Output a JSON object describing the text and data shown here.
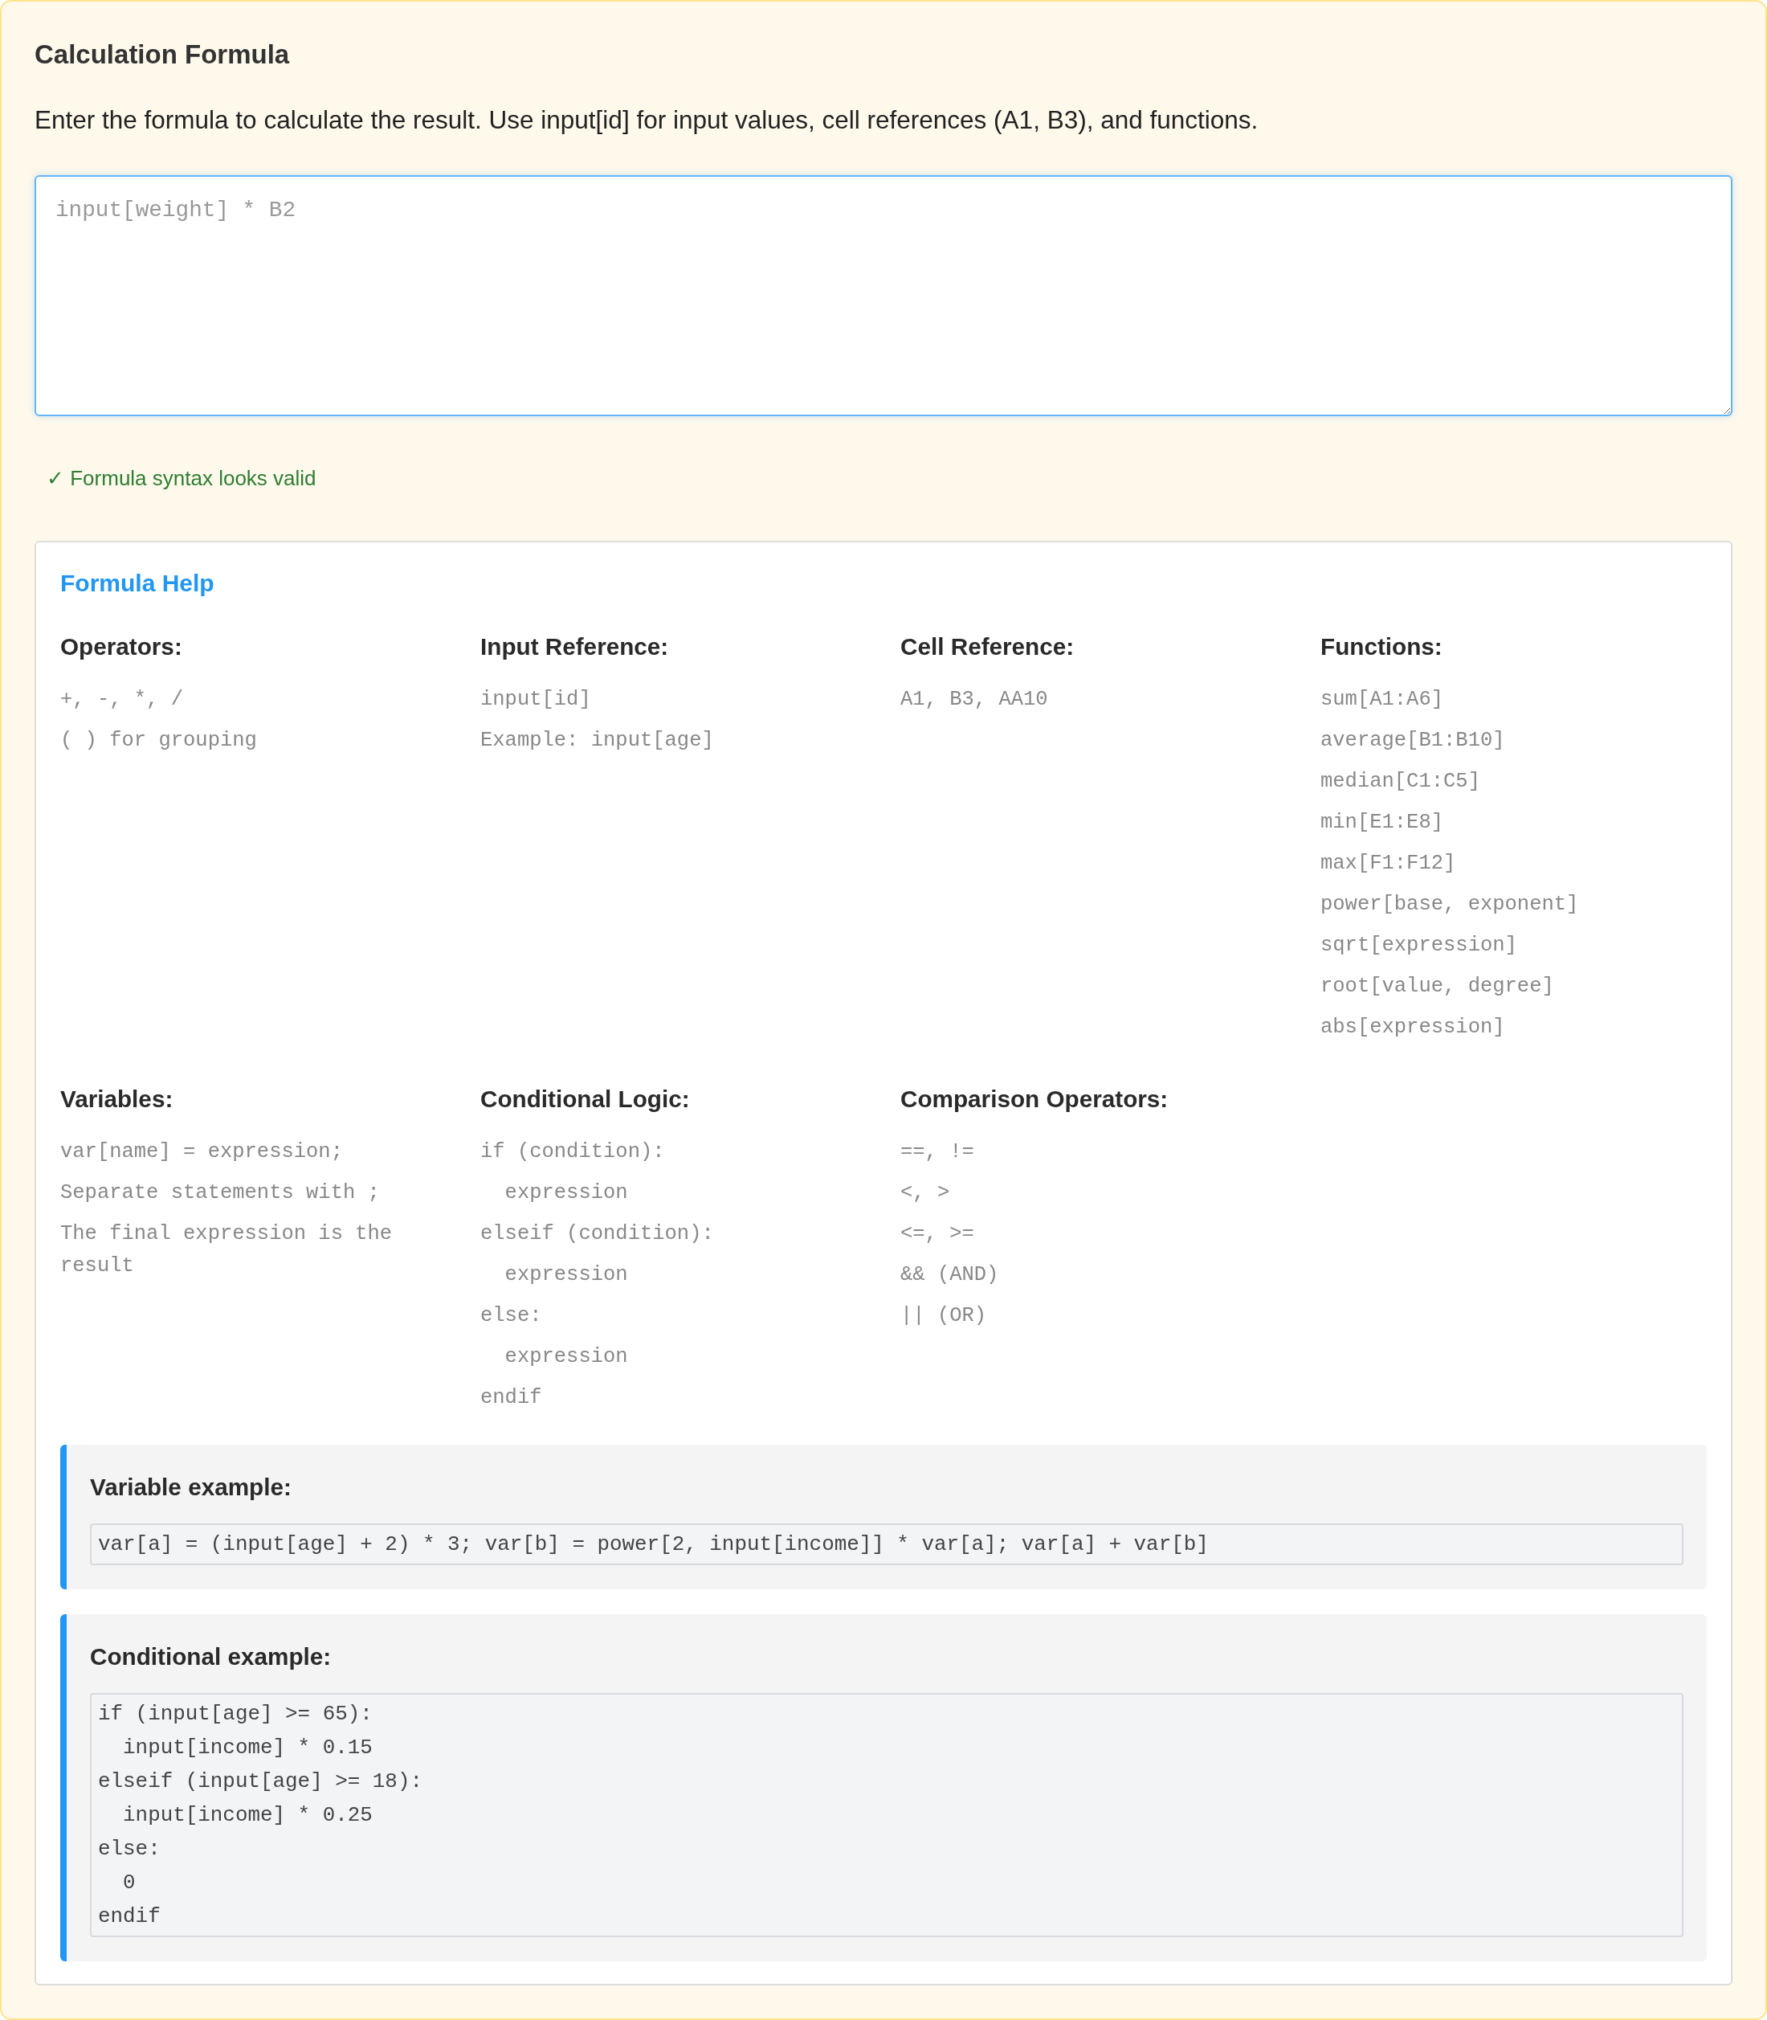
{
  "panel": {
    "title": "Calculation Formula",
    "description": "Enter the formula to calculate the result. Use input[id] for input values, cell references (A1, B3), and functions."
  },
  "formula_field": {
    "placeholder": "input[weight] * B2"
  },
  "validation": {
    "valid": true,
    "text": "✓ Formula syntax looks valid"
  },
  "help": {
    "title": "Formula Help",
    "sections": [
      {
        "heading": "Operators:",
        "items": [
          {
            "text": "+, -, *, /"
          },
          {
            "text": "( ) for grouping"
          }
        ]
      },
      {
        "heading": "Input Reference:",
        "items": [
          {
            "text": "input[id]"
          },
          {
            "text": "Example: input[age]"
          }
        ]
      },
      {
        "heading": "Cell Reference:",
        "items": [
          {
            "text": "A1, B3, AA10"
          }
        ]
      },
      {
        "heading": "Functions:",
        "items": [
          {
            "text": "sum[A1:A6]"
          },
          {
            "text": "average[B1:B10]"
          },
          {
            "text": "median[C1:C5]"
          },
          {
            "text": "min[E1:E8]"
          },
          {
            "text": "max[F1:F12]"
          },
          {
            "text": "power[base, exponent]"
          },
          {
            "text": "sqrt[expression]"
          },
          {
            "text": "root[value, degree]"
          },
          {
            "text": "abs[expression]"
          }
        ]
      },
      {
        "heading": "Variables:",
        "items": [
          {
            "text": "var[name] = expression;"
          },
          {
            "text": "Separate statements with ;"
          },
          {
            "text": "The final expression is the result"
          }
        ]
      },
      {
        "heading": "Conditional Logic:",
        "items": [
          {
            "text": "if (condition):",
            "children": [
              {
                "text": "expression"
              }
            ]
          },
          {
            "text": "elseif (condition):",
            "children": [
              {
                "text": "expression"
              }
            ]
          },
          {
            "text": "else:",
            "children": [
              {
                "text": "expression"
              }
            ]
          },
          {
            "text": "endif"
          }
        ]
      },
      {
        "heading": "Comparison Operators:",
        "items": [
          {
            "text": "==, !="
          },
          {
            "text": "<, >"
          },
          {
            "text": "<=, >="
          },
          {
            "text": "&& (AND)"
          },
          {
            "text": "|| (OR)"
          }
        ]
      }
    ],
    "examples": [
      {
        "heading": "Variable example:",
        "code": "var[a] = (input[age] + 2) * 3; var[b] = power[2, input[income]] * var[a]; var[a] + var[b]"
      },
      {
        "heading": "Conditional example:",
        "code": "if (input[age] >= 65):\n  input[income] * 0.15\nelseif (input[age] >= 18):\n  input[income] * 0.25\nelse:\n  0\nendif"
      }
    ]
  }
}
